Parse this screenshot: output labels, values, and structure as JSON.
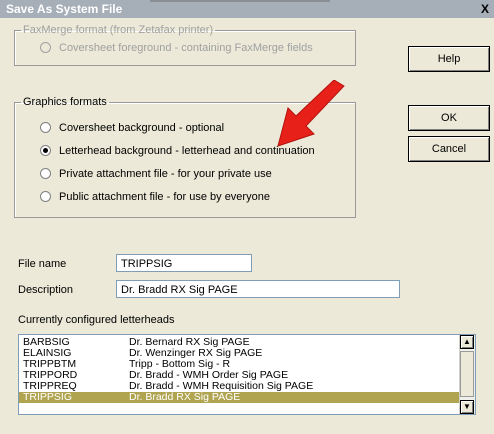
{
  "window": {
    "title": "Save As System File",
    "close_glyph": "X"
  },
  "faxmerge": {
    "legend": "FaxMerge format (from Zetafax printer)",
    "options": [
      "Coversheet foreground - containing FaxMerge fields"
    ]
  },
  "graphics": {
    "legend": "Graphics formats",
    "options": [
      "Coversheet background - optional",
      "Letterhead background - letterhead and continuation",
      "Private attachment file - for your private use",
      "Public attachment file - for use by everyone"
    ],
    "selected_index": 1
  },
  "buttons": {
    "help": "Help",
    "ok": "OK",
    "cancel": "Cancel"
  },
  "fields": {
    "file_name_label": "File name",
    "file_name_value": "TRIPPSIG",
    "description_label": "Description",
    "description_value": "Dr. Bradd RX Sig PAGE"
  },
  "letterheads": {
    "label": "Currently configured letterheads",
    "rows": [
      {
        "name": "BARBSIG",
        "desc": "Dr. Bernard RX Sig PAGE"
      },
      {
        "name": "ELAINSIG",
        "desc": "Dr. Wenzinger RX Sig PAGE"
      },
      {
        "name": "TRIPPBTM",
        "desc": "Tripp - Bottom Sig - R"
      },
      {
        "name": "TRIPPORD",
        "desc": "Dr. Bradd - WMH Order Sig PAGE"
      },
      {
        "name": "TRIPPREQ",
        "desc": "Dr. Bradd - WMH Requisition Sig PAGE"
      },
      {
        "name": "TRIPPSIG",
        "desc": "Dr. Bradd RX Sig PAGE"
      }
    ],
    "selected_index": 5
  },
  "colors": {
    "selection": "#b0a451",
    "arrow": "#e8201a",
    "titlebar": "#a6aeb8"
  }
}
